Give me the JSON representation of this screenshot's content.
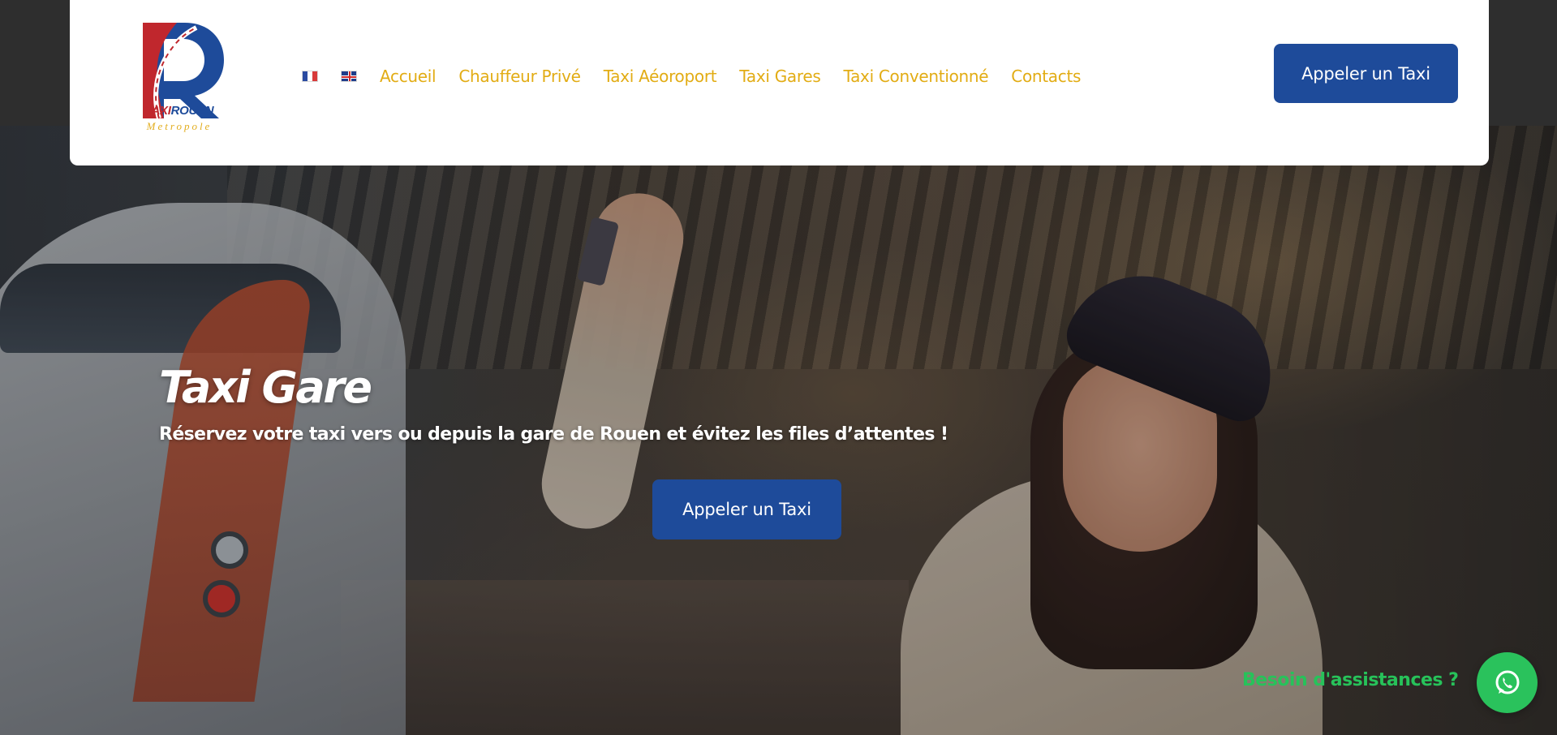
{
  "header": {
    "logo": {
      "wordmark_part1": "TAXI",
      "wordmark_part2": "ROUEN",
      "tagline": "Metropole",
      "colors": {
        "red": "#c0272d",
        "blue": "#1e4b9a",
        "gold": "#e2ad1e"
      }
    },
    "languages": [
      {
        "name": "french-flag-icon"
      },
      {
        "name": "english-flag-icon"
      }
    ],
    "nav": [
      {
        "label": "Accueil"
      },
      {
        "label": "Chauffeur Privé"
      },
      {
        "label": "Taxi Aéoroport"
      },
      {
        "label": "Taxi Gares"
      },
      {
        "label": "Taxi Conventionné"
      },
      {
        "label": "Contacts"
      }
    ],
    "call_button": "Appeler un Taxi"
  },
  "hero": {
    "title": "Taxi Gare",
    "subtitle": "Réservez votre taxi vers ou depuis la gare de Rouen et évitez les files d’attentes !",
    "call_button": "Appeler un Taxi"
  },
  "assistance": {
    "label": "Besoin d'assistances ?",
    "icon": "whatsapp-icon"
  },
  "colors": {
    "brand_blue": "#1e4b9a",
    "nav_gold": "#e2ac14",
    "whatsapp_green": "#2ac25c",
    "assist_text_green": "#27c25a"
  }
}
